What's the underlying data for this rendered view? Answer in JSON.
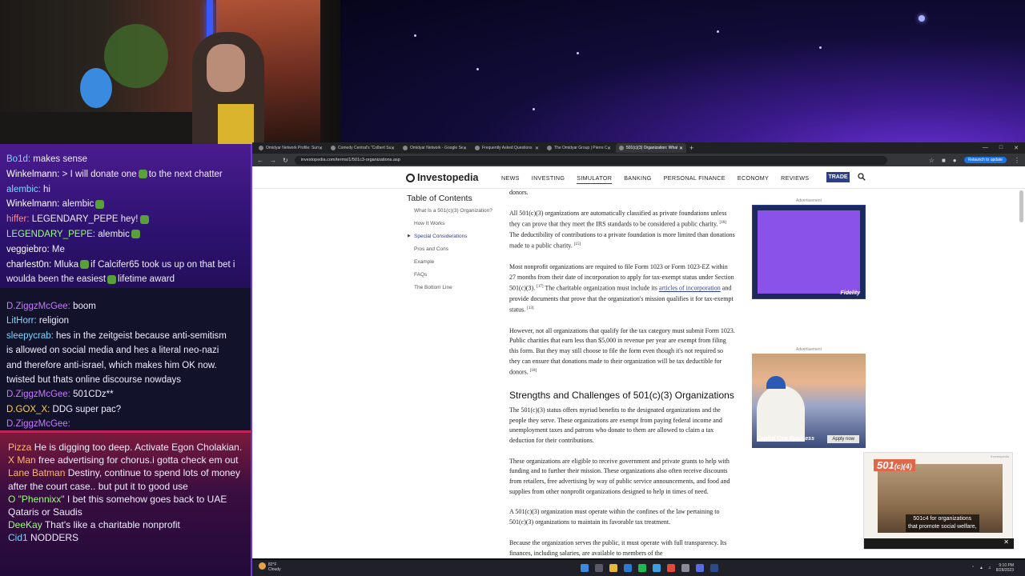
{
  "chat_top": [
    {
      "user": "Bo1d:",
      "user_color": "#7ad8ff",
      "text": "makes sense"
    },
    {
      "user": "Winkelmann:",
      "user_color": "#ffffff",
      "text": "> I will donate one",
      "emote": true,
      "text2": "to the next chatter"
    },
    {
      "user": "alembic:",
      "user_color": "#7ad8ff",
      "text": "hi"
    },
    {
      "user": "Winkelmann:",
      "user_color": "#ffffff",
      "text": "alembic",
      "emote": true,
      "text2": ""
    },
    {
      "user": "hiffer:",
      "user_color": "#ff8a8a",
      "text": "LEGENDARY_PEPE hey!",
      "emote": true,
      "text2": ""
    },
    {
      "user": "LEGENDARY_PEPE:",
      "user_color": "#9aff7a",
      "text": "alembic",
      "emote": true,
      "text2": ""
    },
    {
      "user": "veggiebro:",
      "user_color": "#ffffff",
      "text": "Me"
    },
    {
      "user": "charlest0n:",
      "user_color": "#ffffff",
      "text": "Mluka",
      "emote": true,
      "text2": "if Calcifer65 took us up on that bet i"
    },
    {
      "user": "",
      "user_color": "#ffffff",
      "text": "woulda been the easiest",
      "emote": true,
      "text2": "lifetime award"
    }
  ],
  "chat_mid": [
    {
      "user": "D.ZiggzMcGee:",
      "user_color": "#c77aff",
      "text": "boom"
    },
    {
      "user": "LitHorr:",
      "user_color": "#7ad8ff",
      "text": "religion"
    },
    {
      "user": "sleepycrab:",
      "user_color": "#7ad8ff",
      "text": "hes in the zeitgeist because anti-semitism"
    },
    {
      "user": "",
      "user_color": "#ffffff",
      "text": "is allowed on social media and hes a literal neo-nazi"
    },
    {
      "user": "",
      "user_color": "#ffffff",
      "text": "and therefore anti-israel, which makes him OK now."
    },
    {
      "user": "",
      "user_color": "#ffffff",
      "text": "twisted but thats online discourse nowdays"
    },
    {
      "user": "D.ZiggzMcGee:",
      "user_color": "#c77aff",
      "text": "501CDz**"
    },
    {
      "user": "D.GOX_X:",
      "user_color": "#ffd24a",
      "text": "DDG super pac?"
    },
    {
      "user": "D.ZiggzMcGee:",
      "user_color": "#c77aff",
      "text": ""
    }
  ],
  "chat_bot": [
    {
      "user": "Pizza",
      "user_color": "#ffb86a",
      "text": "He is digging too deep. Activate Egon Cholakian."
    },
    {
      "user": "X Man",
      "user_color": "#ffb86a",
      "text": "free advertising for chorus.i gotta check em out"
    },
    {
      "user": "Lane Batman",
      "user_color": "#ffb86a",
      "text": "Destiny, continue to spend lots of money after the court case.. but put it to good use"
    },
    {
      "user": "O \"Phennixx\"",
      "user_color": "#9aff7a",
      "text": "I bet this somehow goes back to UAE Qataris or Saudis"
    },
    {
      "user": "DeeKay",
      "user_color": "#9aff7a",
      "text": "That's like a charitable nonprofit"
    },
    {
      "user": "Cid1",
      "user_color": "#7ad8ff",
      "text": "NODDERS"
    }
  ],
  "browser": {
    "tabs": [
      {
        "label": "Omidyar Network Profile: Sum",
        "active": false
      },
      {
        "label": "Comedy Central's \"Colbert Su",
        "active": false
      },
      {
        "label": "Omidyar Network - Google Se",
        "active": false
      },
      {
        "label": "Frequently Asked Questions",
        "active": false
      },
      {
        "label": "The Omidyar Group | Pierre Om",
        "active": false
      },
      {
        "label": "501(c)(3) Organization: What",
        "active": true
      }
    ],
    "new_tab": "+",
    "url": "investopedia.com/terms/1/501c3-organizations.asp",
    "relaunch": "Relaunch to update"
  },
  "site": {
    "logo": "Investopedia",
    "nav": [
      "NEWS",
      "INVESTING",
      "SIMULATOR",
      "BANKING",
      "PERSONAL FINANCE",
      "ECONOMY",
      "REVIEWS"
    ],
    "nav_active": "SIMULATOR",
    "trade": "TRADE"
  },
  "toc": {
    "title": "Table of Contents",
    "items": [
      {
        "label": "What Is a 501(c)(3) Organization?",
        "current": false
      },
      {
        "label": "How It Works",
        "current": false
      },
      {
        "label": "Special Considerations",
        "current": true
      },
      {
        "label": "Pros and Cons",
        "current": false
      },
      {
        "label": "Example",
        "current": false
      },
      {
        "label": "FAQs",
        "current": false
      },
      {
        "label": "The Bottom Line",
        "current": false
      }
    ]
  },
  "article": {
    "p0": "donors.",
    "p1": "All 501(c)(3) organizations are automatically classified as private foundations unless they can prove that they meet the IRS standards to be considered a public charity.",
    "p1_ref1": "[16]",
    "p1b": "The deductibility of contributions to a private foundation is more limited than donations made to a public charity.",
    "p1_ref2": "[15]",
    "p2": "Most nonprofit organizations are required to file Form 1023 or Form 1023-EZ within 27 months from their date of incorporation to apply for tax-exempt status under Section 501(c)(3).",
    "p2_ref1": "[17]",
    "p2b": "The charitable organization must include its",
    "p2_link": "articles of incorporation",
    "p2c": "and provide documents that prove that the organization's mission qualifies it for tax-exempt status.",
    "p2_ref2": "[13]",
    "p3": "However, not all organizations that qualify for the tax category must submit Form 1023. Public charities that earn less than $5,000 in revenue per year are exempt from filing this form. But they may still choose to file the form even though it's not required so they can ensure that donations made to their organization will be tax deductible for donors.",
    "p3_ref": "[18]",
    "h2": "Strengths and Challenges of 501(c)(3) Organizations",
    "p4": "The 501(c)(3) status offers myriad benefits to the designated organizations and the people they serve. These organizations are exempt from paying federal income and unemployment taxes and patrons who donate to them are allowed to claim a tax deduction for their contributions.",
    "p5": "These organizations are eligible to receive government and private grants to help with funding and to further their mission. These organizations also often receive discounts from retailers, free advertising by way of public service announcements, and food and supplies from other nonprofit organizations designed to help in times of need.",
    "p6": "A 501(c)(3) organization must operate within the confines of the law pertaining to 501(c)(3) organizations to maintain its favorable tax treatment.",
    "p7": "Because the organization serves the public, it must operate with full transparency. Its finances, including salaries, are available to members of the"
  },
  "ads": {
    "label": "Advertisement",
    "ad1_brand": "Fidelity",
    "ad2_brand": "Capital One Business",
    "ad2_cta": "Apply now"
  },
  "pip": {
    "badge_main": "501",
    "badge_sub": "(c)(4)",
    "caption1": "501c4 for organizations",
    "caption2": "that promote social welfare,",
    "tag": "Investopedia",
    "close": "✕"
  },
  "taskbar": {
    "temp": "82°F",
    "cond": "Cloudy",
    "time": "9:10 PM",
    "date": "8/28/2023"
  },
  "colors": {
    "accent": "#2c3e8c",
    "chat_border": "#6a3ad8",
    "pip_badge": "#e0684a"
  }
}
